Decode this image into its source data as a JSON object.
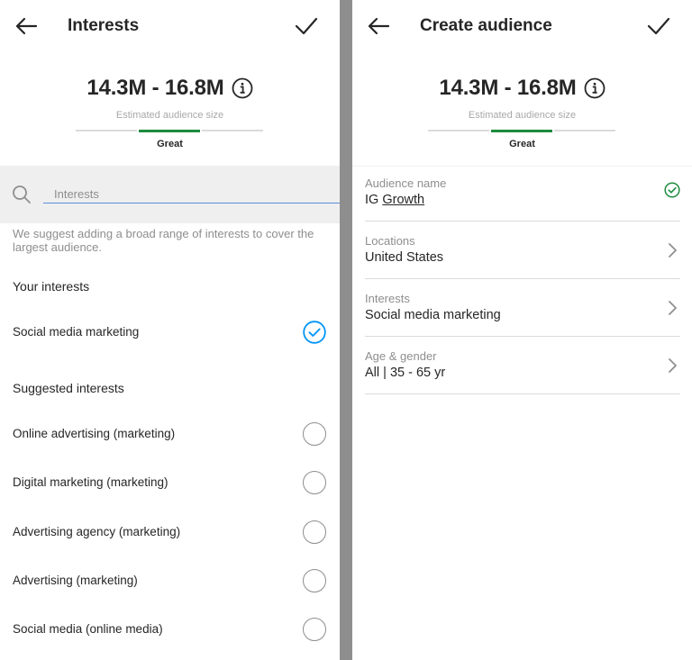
{
  "left": {
    "header": {
      "title": "Interests"
    },
    "audience_size": {
      "value": "14.3M - 16.8M",
      "caption": "Estimated audience size",
      "rating": "Great"
    },
    "search": {
      "placeholder": "Interests"
    },
    "hint": "We suggest adding a broad range of interests to cover the largest audience.",
    "your_interests": {
      "title": "Your interests",
      "items": [
        {
          "label": "Social media marketing",
          "selected": true
        }
      ]
    },
    "suggested_interests": {
      "title": "Suggested interests",
      "items": [
        {
          "label": "Online advertising (marketing)",
          "selected": false
        },
        {
          "label": "Digital marketing (marketing)",
          "selected": false
        },
        {
          "label": "Advertising agency (marketing)",
          "selected": false
        },
        {
          "label": "Advertising (marketing)",
          "selected": false
        },
        {
          "label": "Social media (online media)",
          "selected": false
        }
      ]
    }
  },
  "right": {
    "header": {
      "title": "Create audience"
    },
    "audience_size": {
      "value": "14.3M - 16.8M",
      "caption": "Estimated audience size",
      "rating": "Great"
    },
    "fields": {
      "audience_name": {
        "label": "Audience name",
        "value_prefix": "IG ",
        "value_underlined": "Growth"
      },
      "locations": {
        "label": "Locations",
        "value": "United States"
      },
      "interests": {
        "label": "Interests",
        "value": "Social media marketing"
      },
      "age_gender": {
        "label": "Age & gender",
        "value": "All | 35 - 65 yr"
      }
    }
  },
  "colors": {
    "accent_blue": "#0095f6",
    "success_green": "#1f8b3e",
    "divider_gray": "#8e8e8e",
    "search_bg": "#efefef"
  },
  "icons": {
    "back": "arrow-left-icon",
    "confirm": "checkmark-icon",
    "info": "info-circle-icon",
    "search": "magnifier-icon",
    "chevron": "chevron-right-icon",
    "valid": "check-circle-icon"
  }
}
